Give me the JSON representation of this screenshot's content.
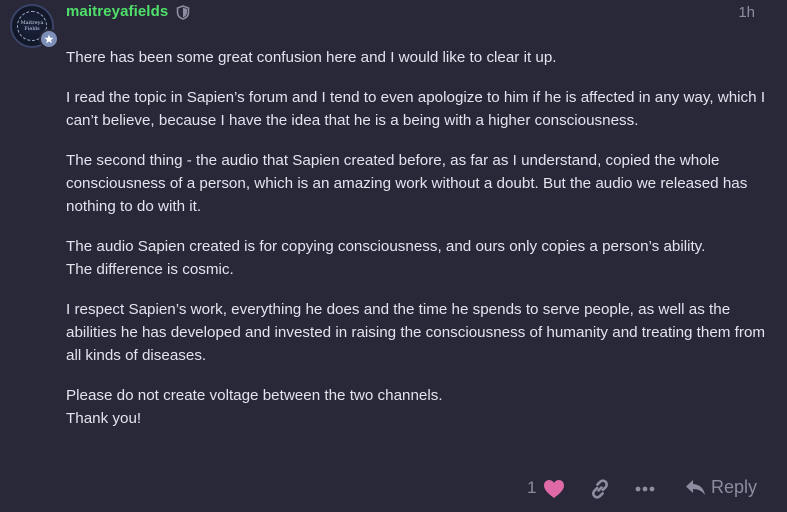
{
  "post": {
    "username": "maitreyafields",
    "timestamp": "1h",
    "avatar_text_line1": "Maitreya",
    "avatar_text_line2": "Fields",
    "paragraphs": [
      {
        "lines": [
          "There has been some great confusion here and I would like to clear it up."
        ]
      },
      {
        "lines": [
          "I read the topic in Sapien’s forum and I tend to even apologize to him if he is affected in any way, which I can’t believe, because I have the idea that he is a being with a higher consciousness."
        ]
      },
      {
        "lines": [
          "The second thing - the audio that Sapien created before, as far as I understand, copied the whole consciousness of a person, which is an amazing work without a doubt. But the audio we released has nothing to do with it."
        ]
      },
      {
        "lines": [
          "The audio Sapien created is for copying consciousness, and ours only copies a person’s ability.",
          "The difference is cosmic."
        ]
      },
      {
        "lines": [
          "I respect Sapien’s work, everything he does and the time he spends to serve people, as well as the abilities he has developed and invested in raising the consciousness of humanity and treating them from all kinds of diseases."
        ]
      },
      {
        "lines": [
          "Please do not create voltage between the two channels.",
          "Thank you!"
        ]
      }
    ]
  },
  "actions": {
    "like_count": "1",
    "reply_label": "Reply"
  },
  "colors": {
    "background": "#292838",
    "username": "#4ee06a",
    "body_text": "#e4e3ee",
    "muted": "#8d8ca0",
    "heart": "#e06aa8"
  },
  "icons": {
    "shield": "shield-icon",
    "heart": "heart-icon",
    "link": "link-icon",
    "more": "ellipsis-icon",
    "reply": "reply-arrow-icon"
  }
}
